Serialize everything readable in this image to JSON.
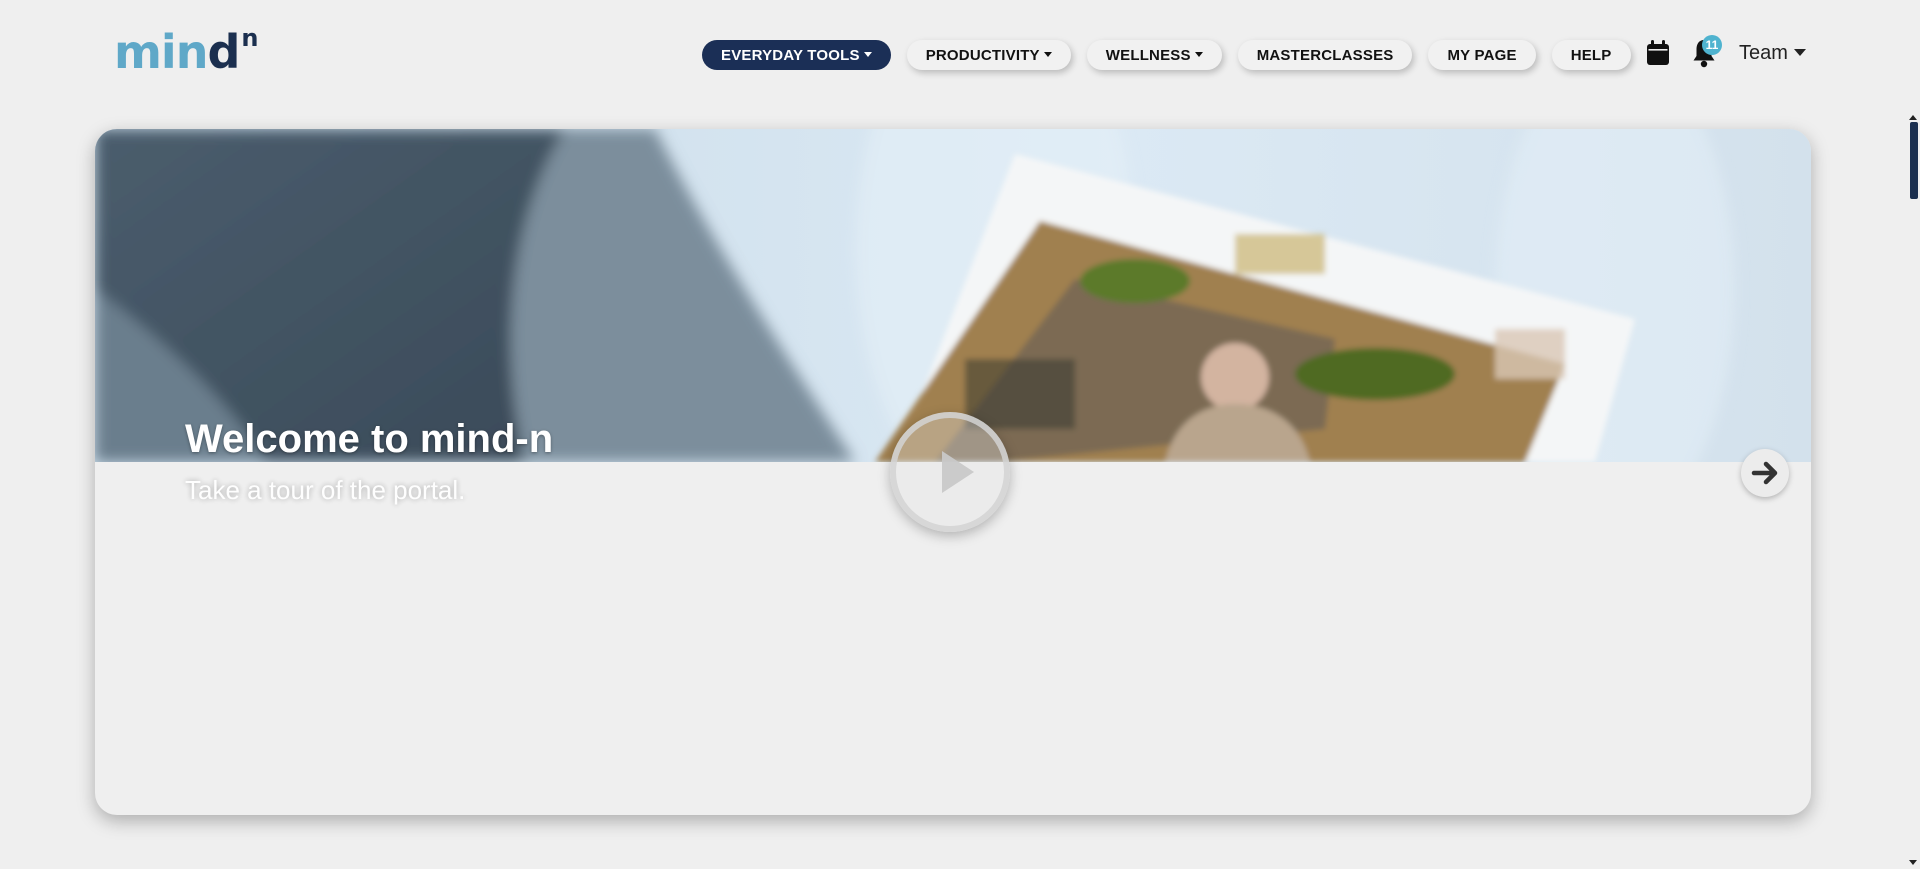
{
  "brand": {
    "logo_mind": "min",
    "logo_d": "d",
    "logo_sup": "n",
    "colors": {
      "primary_dark": "#1b2f56",
      "accent_blue": "#5fa8c8",
      "badge": "#4fb3cf"
    }
  },
  "nav": {
    "items": [
      {
        "label": "EVERYDAY TOOLS",
        "dropdown": true,
        "active": true
      },
      {
        "label": "PRODUCTIVITY",
        "dropdown": true,
        "active": false
      },
      {
        "label": "WELLNESS",
        "dropdown": true,
        "active": false
      },
      {
        "label": "MASTERCLASSES",
        "dropdown": false,
        "active": false
      },
      {
        "label": "MY PAGE",
        "dropdown": false,
        "active": false
      },
      {
        "label": "HELP",
        "dropdown": false,
        "active": false
      }
    ],
    "calendar_icon": "calendar-icon",
    "notifications_icon": "bell-icon",
    "notification_count": "11",
    "user_menu_label": "Team"
  },
  "hero": {
    "title": "Welcome to mind-n",
    "subtitle": "Take a tour of the portal.",
    "play_icon": "play-icon",
    "next_icon": "arrow-right-icon"
  }
}
